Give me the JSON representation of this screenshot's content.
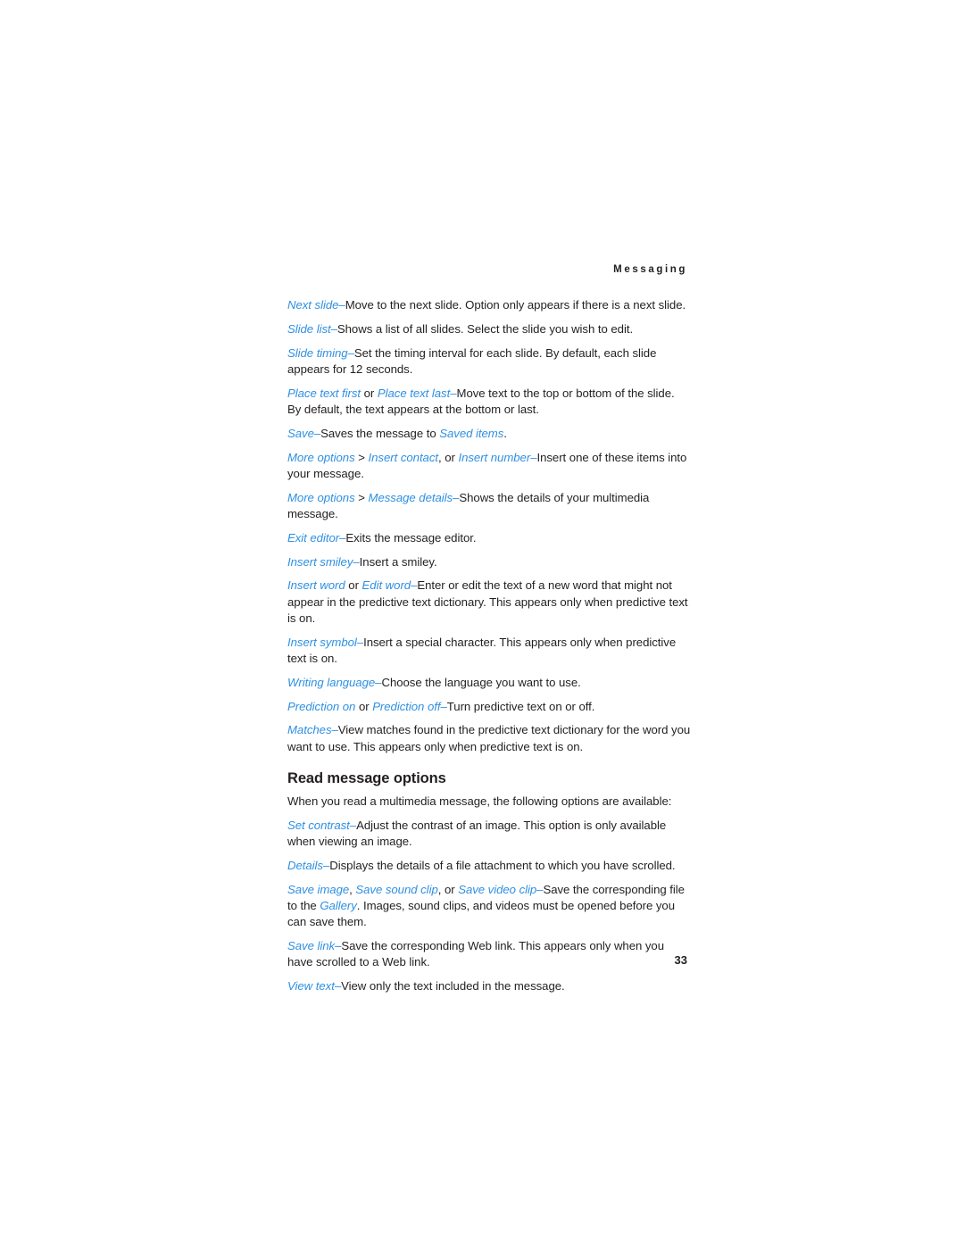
{
  "document": {
    "running_header": "Messaging",
    "page_number": "33",
    "accent_color": "#2e90e2",
    "text_color": "#231f20",
    "background_color": "#ffffff"
  },
  "body": {
    "paragraphs": [
      {
        "id": "next-slide",
        "runs": [
          {
            "text": "Next slide",
            "style": "ui"
          },
          {
            "text": "–",
            "style": "dash"
          },
          {
            "text": "Move to the next slide. Option only appears if there is a next slide.",
            "style": "plain"
          }
        ]
      },
      {
        "id": "slide-list",
        "runs": [
          {
            "text": "Slide list",
            "style": "ui"
          },
          {
            "text": "–",
            "style": "dash"
          },
          {
            "text": "Shows a list of all slides. Select the slide you wish to edit.",
            "style": "plain"
          }
        ]
      },
      {
        "id": "slide-timing",
        "runs": [
          {
            "text": "Slide timing",
            "style": "ui"
          },
          {
            "text": "–",
            "style": "dash"
          },
          {
            "text": "Set the timing interval for each slide. By default, each slide appears for 12 seconds.",
            "style": "plain"
          }
        ]
      },
      {
        "id": "place-text",
        "runs": [
          {
            "text": "Place text first",
            "style": "ui"
          },
          {
            "text": " or ",
            "style": "plain"
          },
          {
            "text": "Place text last",
            "style": "ui"
          },
          {
            "text": "–",
            "style": "dash"
          },
          {
            "text": "Move text to the top or bottom of the slide. By default, the text appears at the bottom or last.",
            "style": "plain"
          }
        ]
      },
      {
        "id": "save",
        "runs": [
          {
            "text": "Save",
            "style": "ui"
          },
          {
            "text": "–",
            "style": "dash"
          },
          {
            "text": "Saves the message to ",
            "style": "plain"
          },
          {
            "text": "Saved items",
            "style": "ui"
          },
          {
            "text": ".",
            "style": "plain"
          }
        ]
      },
      {
        "id": "more-options-insert",
        "runs": [
          {
            "text": "More options",
            "style": "ui"
          },
          {
            "text": " > ",
            "style": "sep"
          },
          {
            "text": "Insert contact",
            "style": "ui"
          },
          {
            "text": ", or ",
            "style": "plain"
          },
          {
            "text": "Insert number",
            "style": "ui"
          },
          {
            "text": "–",
            "style": "dash"
          },
          {
            "text": "Insert one of these items into your message.",
            "style": "plain"
          }
        ]
      },
      {
        "id": "more-options-message-details",
        "runs": [
          {
            "text": "More options",
            "style": "ui"
          },
          {
            "text": " > ",
            "style": "sep"
          },
          {
            "text": "Message details",
            "style": "ui"
          },
          {
            "text": "–",
            "style": "dash"
          },
          {
            "text": "Shows the details of your multimedia message.",
            "style": "plain"
          }
        ]
      },
      {
        "id": "exit-editor",
        "runs": [
          {
            "text": "Exit editor",
            "style": "ui"
          },
          {
            "text": "–",
            "style": "dash"
          },
          {
            "text": "Exits the message editor.",
            "style": "plain"
          }
        ]
      },
      {
        "id": "insert-smiley",
        "runs": [
          {
            "text": "Insert smiley",
            "style": "ui"
          },
          {
            "text": "–",
            "style": "dash"
          },
          {
            "text": "Insert a smiley.",
            "style": "plain"
          }
        ]
      },
      {
        "id": "insert-word",
        "runs": [
          {
            "text": "Insert word",
            "style": "ui"
          },
          {
            "text": " or ",
            "style": "plain"
          },
          {
            "text": "Edit word",
            "style": "ui"
          },
          {
            "text": "–",
            "style": "dash"
          },
          {
            "text": "Enter or edit the text of a new word that might not appear in the predictive text dictionary. This appears only when predictive text is on.",
            "style": "plain"
          }
        ]
      },
      {
        "id": "insert-symbol",
        "runs": [
          {
            "text": "Insert symbol",
            "style": "ui"
          },
          {
            "text": "–",
            "style": "dash"
          },
          {
            "text": "Insert a special character. This appears only when predictive text is on.",
            "style": "plain"
          }
        ]
      },
      {
        "id": "writing-language",
        "runs": [
          {
            "text": "Writing language",
            "style": "ui"
          },
          {
            "text": "–",
            "style": "dash"
          },
          {
            "text": "Choose the language you want to use.",
            "style": "plain"
          }
        ]
      },
      {
        "id": "prediction",
        "runs": [
          {
            "text": "Prediction on",
            "style": "ui"
          },
          {
            "text": " or ",
            "style": "plain"
          },
          {
            "text": "Prediction off",
            "style": "ui"
          },
          {
            "text": "–",
            "style": "dash"
          },
          {
            "text": "Turn predictive text on or off.",
            "style": "plain"
          }
        ]
      },
      {
        "id": "matches",
        "runs": [
          {
            "text": "Matches",
            "style": "ui"
          },
          {
            "text": "–",
            "style": "dash"
          },
          {
            "text": "View matches found in the predictive text dictionary for the word you want to use. This appears only when predictive text is on.",
            "style": "plain"
          }
        ]
      }
    ],
    "section": {
      "heading": "Read message options",
      "paragraphs": [
        {
          "id": "read-intro",
          "runs": [
            {
              "text": "When you read a multimedia message, the following options are available:",
              "style": "plain"
            }
          ]
        },
        {
          "id": "set-contrast",
          "runs": [
            {
              "text": "Set contrast",
              "style": "ui"
            },
            {
              "text": "–",
              "style": "dash"
            },
            {
              "text": "Adjust the contrast of an image. This option is only available when viewing an image.",
              "style": "plain"
            }
          ]
        },
        {
          "id": "details",
          "runs": [
            {
              "text": "Details",
              "style": "ui"
            },
            {
              "text": "–",
              "style": "dash"
            },
            {
              "text": "Displays the details of a file attachment to which you have scrolled.",
              "style": "plain"
            }
          ]
        },
        {
          "id": "save-media",
          "runs": [
            {
              "text": "Save image",
              "style": "ui"
            },
            {
              "text": ", ",
              "style": "sep"
            },
            {
              "text": "Save sound clip",
              "style": "ui"
            },
            {
              "text": ", or ",
              "style": "plain"
            },
            {
              "text": "Save video clip",
              "style": "ui"
            },
            {
              "text": "–",
              "style": "dash"
            },
            {
              "text": "Save the corresponding file to the ",
              "style": "plain"
            },
            {
              "text": "Gallery",
              "style": "ui"
            },
            {
              "text": ". Images, sound clips, and videos must be opened before you can save them.",
              "style": "plain"
            }
          ]
        },
        {
          "id": "save-link",
          "runs": [
            {
              "text": "Save link",
              "style": "ui"
            },
            {
              "text": "–",
              "style": "dash"
            },
            {
              "text": "Save the corresponding Web link. This appears only when you have scrolled to a Web link.",
              "style": "plain"
            }
          ]
        },
        {
          "id": "view-text",
          "runs": [
            {
              "text": "View text",
              "style": "ui"
            },
            {
              "text": "–",
              "style": "dash"
            },
            {
              "text": "View only the text included in the message.",
              "style": "plain"
            }
          ]
        }
      ]
    }
  }
}
